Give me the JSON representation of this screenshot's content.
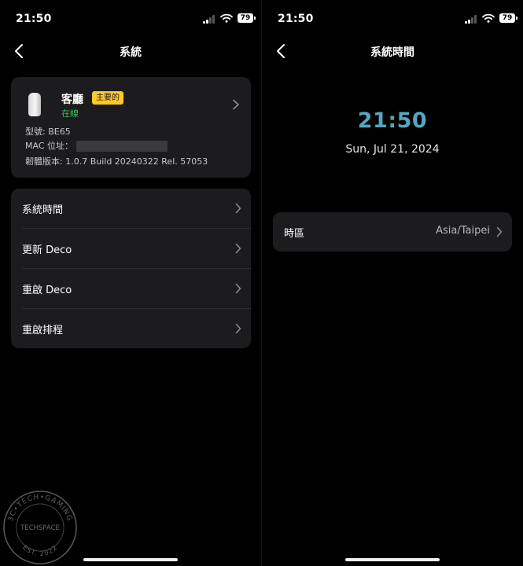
{
  "left": {
    "status": {
      "time": "21:50",
      "battery": "79"
    },
    "nav": {
      "title": "系統"
    },
    "device": {
      "name": "客廳",
      "role_badge": "主要的",
      "status": "在線",
      "model": "型號: BE65",
      "mac_label": "MAC 位址：",
      "firmware": "韌體版本: 1.0.7 Build 20240322 Rel. 57053"
    },
    "menu": [
      {
        "label": "系統時間"
      },
      {
        "label": "更新 Deco"
      },
      {
        "label": "重啟 Deco"
      },
      {
        "label": "重啟排程"
      }
    ]
  },
  "right": {
    "status": {
      "time": "21:50",
      "battery": "79"
    },
    "nav": {
      "title": "系統時間"
    },
    "clock": "21:50",
    "date": "Sun, Jul 21, 2024",
    "timezone": {
      "label": "時區",
      "value": "Asia/Taipei"
    }
  },
  "watermark": {
    "top": "3C•TECH•GAMING",
    "middle": "TECHSPACE",
    "bottom": "EST. 2022"
  },
  "colors": {
    "background": "#000000",
    "card": "#1c1c1e",
    "badge": "#ffc82c",
    "online": "#35c25b",
    "clock": "#56a6c2"
  }
}
